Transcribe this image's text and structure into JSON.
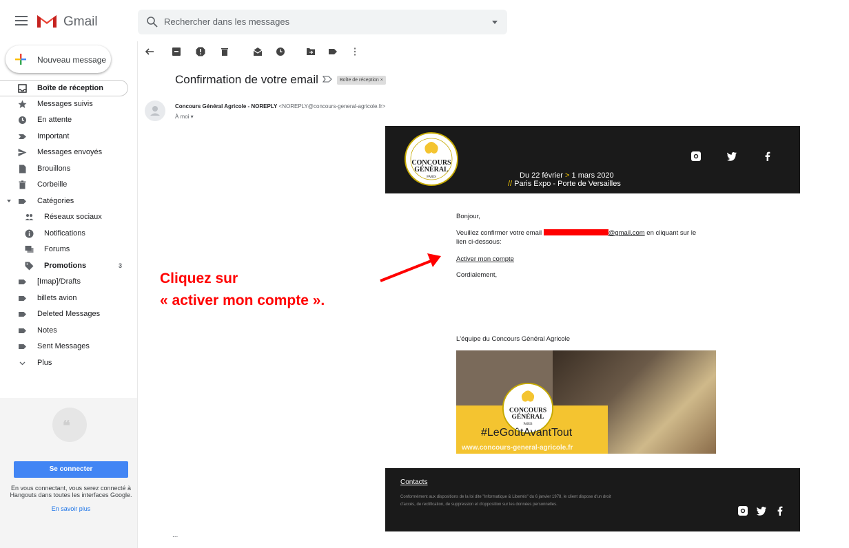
{
  "app": {
    "name": "Gmail",
    "brand_colors": {
      "red": "#ea4335",
      "blue": "#4285f4",
      "green": "#34a853",
      "yellow": "#fbbc04"
    }
  },
  "search": {
    "placeholder": "Rechercher dans les messages"
  },
  "compose": {
    "label": "Nouveau message"
  },
  "sidebar": {
    "items": [
      {
        "label": "Boîte de réception",
        "icon": "inbox-icon"
      },
      {
        "label": "Messages suivis",
        "icon": "star-icon"
      },
      {
        "label": "En attente",
        "icon": "clock-icon"
      },
      {
        "label": "Important",
        "icon": "important-icon"
      },
      {
        "label": "Messages envoyés",
        "icon": "send-icon"
      },
      {
        "label": "Brouillons",
        "icon": "draft-icon"
      },
      {
        "label": "Corbeille",
        "icon": "trash-icon"
      },
      {
        "label": "Catégories",
        "icon": "label-icon"
      },
      {
        "label": "Réseaux sociaux",
        "icon": "people-icon"
      },
      {
        "label": "Notifications",
        "icon": "info-icon"
      },
      {
        "label": "Forums",
        "icon": "forum-icon"
      },
      {
        "label": "Promotions",
        "icon": "tag-icon",
        "count": "3"
      },
      {
        "label": "[Imap]/Drafts",
        "icon": "label-icon"
      },
      {
        "label": "billets avion",
        "icon": "label-icon"
      },
      {
        "label": "Deleted Messages",
        "icon": "label-icon"
      },
      {
        "label": "Notes",
        "icon": "label-icon"
      },
      {
        "label": "Sent Messages",
        "icon": "label-icon"
      },
      {
        "label": "Plus",
        "icon": "chevron-down-icon"
      }
    ]
  },
  "hangouts": {
    "signin_label": "Se connecter",
    "text": "En vous connectant, vous serez connecté à Hangouts dans toutes les interfaces Google.",
    "link": "En savoir plus"
  },
  "email": {
    "subject": "Confirmation de votre email",
    "label_chip": "Boîte de réception ×",
    "sender_name": "Concours Général Agricole - NOREPLY",
    "sender_email": "<NOREPLY@concours-general-agricole.fr>",
    "to": "À moi ▾",
    "ellipsis": "...",
    "banner": {
      "date_start": "Du 22 février ",
      "date_arrow": ">",
      "date_end": " 1 mars 2020",
      "venue_prefix": "//",
      "venue": " Paris Expo - Porte de Versailles"
    },
    "greeting": "Bonjour,",
    "body_line1_prefix": "Veuillez confirmer votre email ",
    "body_email_suffix": "@gmail.com",
    "body_line1_suffix": " en cliquant sur le",
    "body_line2": "lien ci-dessous:",
    "activate_link": "Activer mon compte",
    "closing": "Cordialement,",
    "team": "L'équipe du Concours Général Agricole",
    "promo_hashtag": "#LeGoûtAvantTout",
    "promo_url": "www.concours-general-agricole.fr",
    "footer_title": "Contacts",
    "footer_text": "Conformément aux dispositions de la loi dite \"Informatique & Libertés\" du 6 janvier 1978, le client dispose d'un droit d'accès, de rectification, de suppression et d'opposition sur les données personnelles."
  },
  "annotation": {
    "line1": "Cliquez sur",
    "line2": "« activer mon compte ».",
    "color": "#ff0000"
  }
}
